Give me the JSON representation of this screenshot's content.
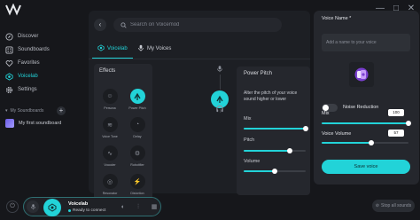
{
  "sidebar": {
    "items": [
      {
        "label": "Discover",
        "icon": "compass-icon"
      },
      {
        "label": "Soundboards",
        "icon": "grid-icon"
      },
      {
        "label": "Favorites",
        "icon": "heart-icon"
      },
      {
        "label": "Voicelab",
        "icon": "voicelab-icon",
        "active": true
      },
      {
        "label": "Settings",
        "icon": "gear-icon"
      }
    ],
    "section_label": "My Soundboards",
    "soundboard": "My first soundboard"
  },
  "main": {
    "search_placeholder": "Search on Voicemod",
    "tabs": [
      {
        "label": "Voicelab",
        "active": true
      },
      {
        "label": "My Voices",
        "active": false
      }
    ],
    "effects": {
      "title": "Effects",
      "items": [
        {
          "label": "Persona",
          "active": false
        },
        {
          "label": "Power Pitch",
          "active": true
        },
        {
          "label": "Voice Tone",
          "active": false
        },
        {
          "label": "Delay",
          "active": false
        },
        {
          "label": "Vocoder",
          "active": false
        },
        {
          "label": "Robotifier",
          "active": false
        },
        {
          "label": "Resonator",
          "active": false
        },
        {
          "label": "Distortion",
          "active": false
        }
      ]
    },
    "pitch_card": {
      "title": "Power Pitch",
      "description": "Alter the pitch of your voice sound higher or lower",
      "sliders": [
        {
          "label": "Mix",
          "value": 1.0
        },
        {
          "label": "Pitch",
          "value": 0.74
        },
        {
          "label": "Volume",
          "value": 0.5
        }
      ]
    }
  },
  "right_panel": {
    "voice_name_label": "Voice Name *",
    "voice_name_placeholder": "Add a name to your voice",
    "noise_reduction_label": "Noise Reduction",
    "noise_reduction_on": false,
    "mix_label": "Mix",
    "mix_value": "100",
    "voice_volume_label": "Voice Volume",
    "voice_volume_value": "57",
    "save_label": "Save voice"
  },
  "bottom": {
    "voice_name": "Voicelab",
    "status": "Ready to connect",
    "stop_label": "Stop all sounds"
  },
  "colors": {
    "accent": "#22d3d8",
    "background": "#16171b",
    "panel": "#25272d"
  }
}
